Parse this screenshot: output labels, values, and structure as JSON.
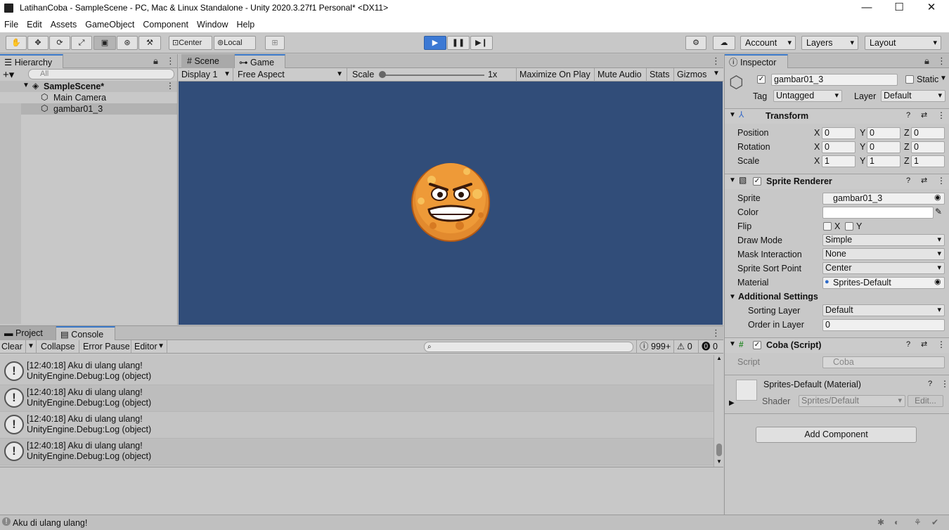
{
  "window": {
    "title": "LatihanCoba - SampleScene - PC, Mac & Linux Standalone - Unity 2020.3.27f1 Personal* <DX11>",
    "min": "—",
    "max": "☐",
    "close": "✕"
  },
  "menu": [
    "File",
    "Edit",
    "Assets",
    "GameObject",
    "Component",
    "Window",
    "Help"
  ],
  "toolbar": {
    "center": "Center",
    "local": "Local",
    "account": "Account",
    "layers": "Layers",
    "layout": "Layout"
  },
  "hierarchy": {
    "tab": "Hierarchy",
    "search_placeholder": "All",
    "scene": "SampleScene*",
    "items": [
      "Main Camera",
      "gambar01_3"
    ]
  },
  "game": {
    "tab_scene": "Scene",
    "tab_game": "Game",
    "display": "Display 1",
    "aspect": "Free Aspect",
    "scale_label": "Scale",
    "scale_value": "1x",
    "maximize": "Maximize On Play",
    "mute": "Mute Audio",
    "stats": "Stats",
    "gizmos": "Gizmos"
  },
  "inspector": {
    "tab": "Inspector",
    "name": "gambar01_3",
    "static": "Static",
    "tag_label": "Tag",
    "tag": "Untagged",
    "layer_label": "Layer",
    "layer": "Default",
    "transform": {
      "title": "Transform",
      "rows": [
        {
          "label": "Position",
          "x": "0",
          "y": "0",
          "z": "0"
        },
        {
          "label": "Rotation",
          "x": "0",
          "y": "0",
          "z": "0"
        },
        {
          "label": "Scale",
          "x": "1",
          "y": "1",
          "z": "1"
        }
      ]
    },
    "sprite_renderer": {
      "title": "Sprite Renderer",
      "sprite_label": "Sprite",
      "sprite": "gambar01_3",
      "color_label": "Color",
      "flip_label": "Flip",
      "flip_x": "X",
      "flip_y": "Y",
      "draw_mode_label": "Draw Mode",
      "draw_mode": "Simple",
      "mask_label": "Mask Interaction",
      "mask": "None",
      "sort_point_label": "Sprite Sort Point",
      "sort_point": "Center",
      "material_label": "Material",
      "material": "Sprites-Default",
      "additional": "Additional Settings",
      "sorting_layer_label": "Sorting Layer",
      "sorting_layer": "Default",
      "order_label": "Order in Layer",
      "order": "0"
    },
    "script": {
      "title": "Coba (Script)",
      "label": "Script",
      "value": "Coba"
    },
    "material": {
      "title": "Sprites-Default (Material)",
      "shader_label": "Shader",
      "shader": "Sprites/Default",
      "edit": "Edit..."
    },
    "add_component": "Add Component"
  },
  "console": {
    "tab_project": "Project",
    "tab_console": "Console",
    "clear": "Clear",
    "collapse": "Collapse",
    "error_pause": "Error Pause",
    "editor": "Editor",
    "count_log": "999+",
    "count_warn": "0",
    "count_err": "0",
    "logs": [
      {
        "line1": "[12:40:18] Aku di ulang ulang!",
        "line2": "UnityEngine.Debug:Log (object)"
      },
      {
        "line1": "[12:40:18] Aku di ulang ulang!",
        "line2": "UnityEngine.Debug:Log (object)"
      },
      {
        "line1": "[12:40:18] Aku di ulang ulang!",
        "line2": "UnityEngine.Debug:Log (object)"
      },
      {
        "line1": "[12:40:18] Aku di ulang ulang!",
        "line2": "UnityEngine.Debug:Log (object)"
      }
    ]
  },
  "status": {
    "message": "Aku di ulang ulang!"
  },
  "colors": {
    "game_bg": "#314d79",
    "play_active": "#3c79d4",
    "sprite": "#e8892a"
  }
}
